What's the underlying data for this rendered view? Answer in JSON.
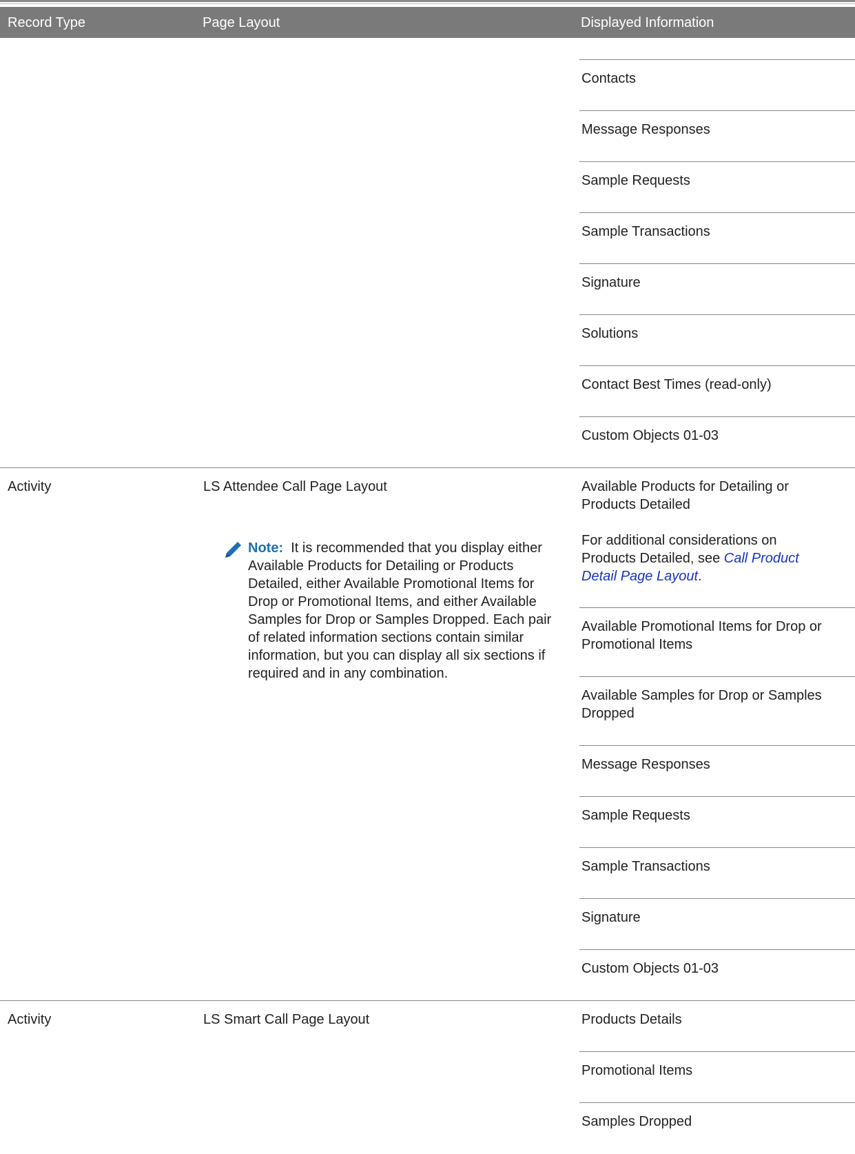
{
  "table": {
    "headers": [
      "Record Type",
      "Page Layout",
      "Displayed Information"
    ],
    "continued_items": [
      "Contacts",
      "Message Responses",
      "Sample Requests",
      "Sample Transactions",
      "Signature",
      "Solutions",
      "Contact Best Times (read-only)",
      "Custom Objects 01-03"
    ],
    "row2": {
      "record_type": "Activity",
      "page_layout": "LS Attendee Call Page Layout",
      "note_label": "Note:",
      "note_text": "It is recommended that you display either Available Products for Detailing or Products Detailed, either Available Promotional Items for Drop or Promotional Items, and either Available Samples for Drop or Samples Dropped. Each pair of related information sections contain similar information, but you can display all six sections if required and in any combination.",
      "item1_line1": "Available Products for Detailing or",
      "item1_line2": "Products Detailed",
      "item1_extra_prefix": "For additional considerations on Products Detailed, see ",
      "item1_link": "Call Product Detail Page Layout",
      "item1_extra_suffix": ".",
      "items": [
        "Available Promotional Items for Drop or Promotional Items",
        "Available Samples for Drop or Samples Dropped",
        "Message Responses",
        "Sample Requests",
        "Sample Transactions",
        "Signature",
        "Custom Objects 01-03"
      ]
    },
    "row3": {
      "record_type": "Activity",
      "page_layout": "LS Smart Call Page Layout",
      "items": [
        "Products Details",
        "Promotional Items",
        "Samples Dropped"
      ]
    }
  },
  "colors": {
    "header_bg": "#7a7a7a",
    "note_label": "#1f6fb5",
    "link": "#1533c9"
  },
  "icons": {
    "note": "pencil-icon"
  }
}
